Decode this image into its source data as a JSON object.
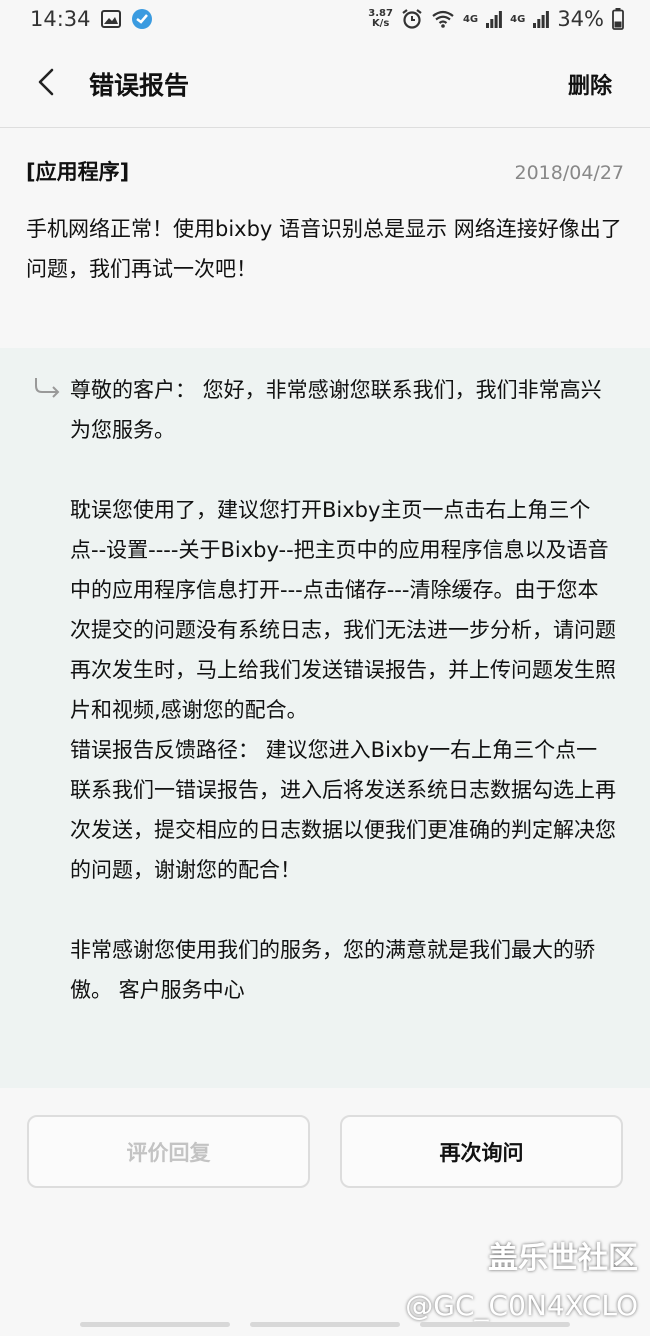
{
  "status": {
    "time": "14:34",
    "speed_value": "3.87",
    "speed_unit": "K/s",
    "net1": "4G",
    "net2": "4G",
    "battery": "34%"
  },
  "header": {
    "title": "错误报告",
    "delete_label": "删除"
  },
  "question": {
    "category": "[应用程序]",
    "date": "2018/04/27",
    "text": "手机网络正常！使用bixby 语音识别总是显示 网络连接好像出了问题，我们再试一次吧！"
  },
  "answer": {
    "greeting": "尊敬的客户： 您好，非常感谢您联系我们，我们非常高兴为您服务。",
    "para2": "耽误您使用了，建议您打开Bixby主页一点击右上角三个点--设置----关于Bixby--把主页中的应用程序信息以及语音中的应用程序信息打开---点击储存---清除缓存。由于您本次提交的问题没有系统日志，我们无法进一步分析，请问题再次发生时，马上给我们发送错误报告，并上传问题发生照片和视频,感谢您的配合。",
    "para3": "错误报告反馈路径： 建议您进入Bixby一右上角三个点一联系我们一错误报告，进入后将发送系统日志数据勾选上再次发送，提交相应的日志数据以便我们更准确的判定解决您的问题，谢谢您的配合！",
    "closing": "非常感谢您使用我们的服务，您的满意就是我们最大的骄傲。 客户服务中心"
  },
  "actions": {
    "rate_label": "评价回复",
    "ask_again_label": "再次询问"
  },
  "watermark": {
    "line1": "盖乐世社区",
    "line2": "@GC_C0N4XCLO"
  }
}
